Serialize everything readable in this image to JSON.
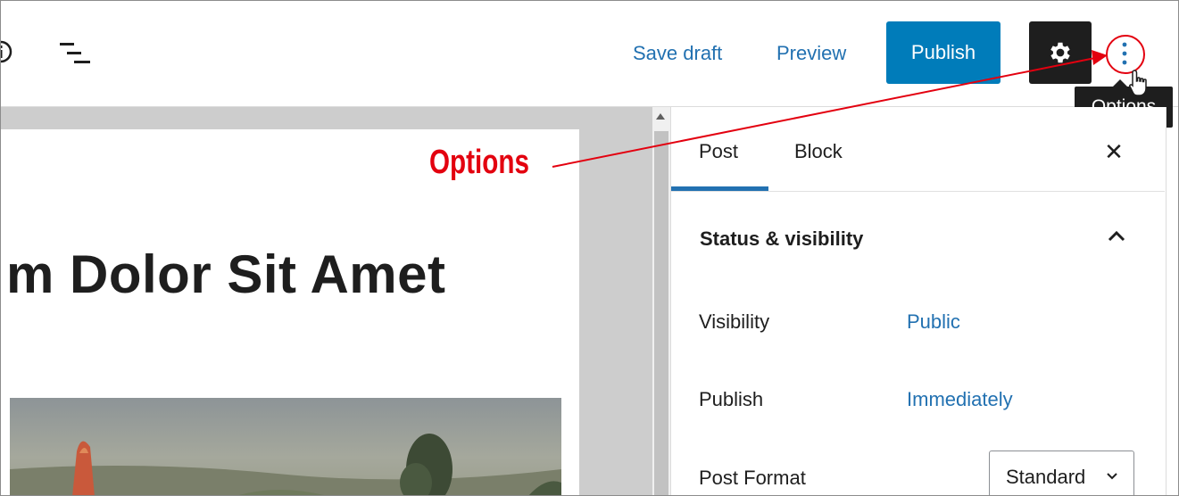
{
  "header": {
    "save_draft_label": "Save draft",
    "preview_label": "Preview",
    "publish_label": "Publish",
    "tooltip": "Options"
  },
  "editor": {
    "title_fragment": "m Dolor Sit Amet"
  },
  "sidebar": {
    "tabs": [
      {
        "label": "Post",
        "active": true
      },
      {
        "label": "Block",
        "active": false
      }
    ],
    "close_symbol": "✕",
    "panel": {
      "title": "Status & visibility",
      "rows": [
        {
          "label": "Visibility",
          "value": "Public"
        },
        {
          "label": "Publish",
          "value": "Immediately"
        },
        {
          "label": "Post Format",
          "value": "Standard"
        }
      ]
    }
  },
  "annotation": {
    "label": "Options"
  },
  "colors": {
    "accent": "#007cba",
    "link": "#2271b1",
    "annotation": "#e3000f",
    "dark": "#1e1e1e"
  }
}
